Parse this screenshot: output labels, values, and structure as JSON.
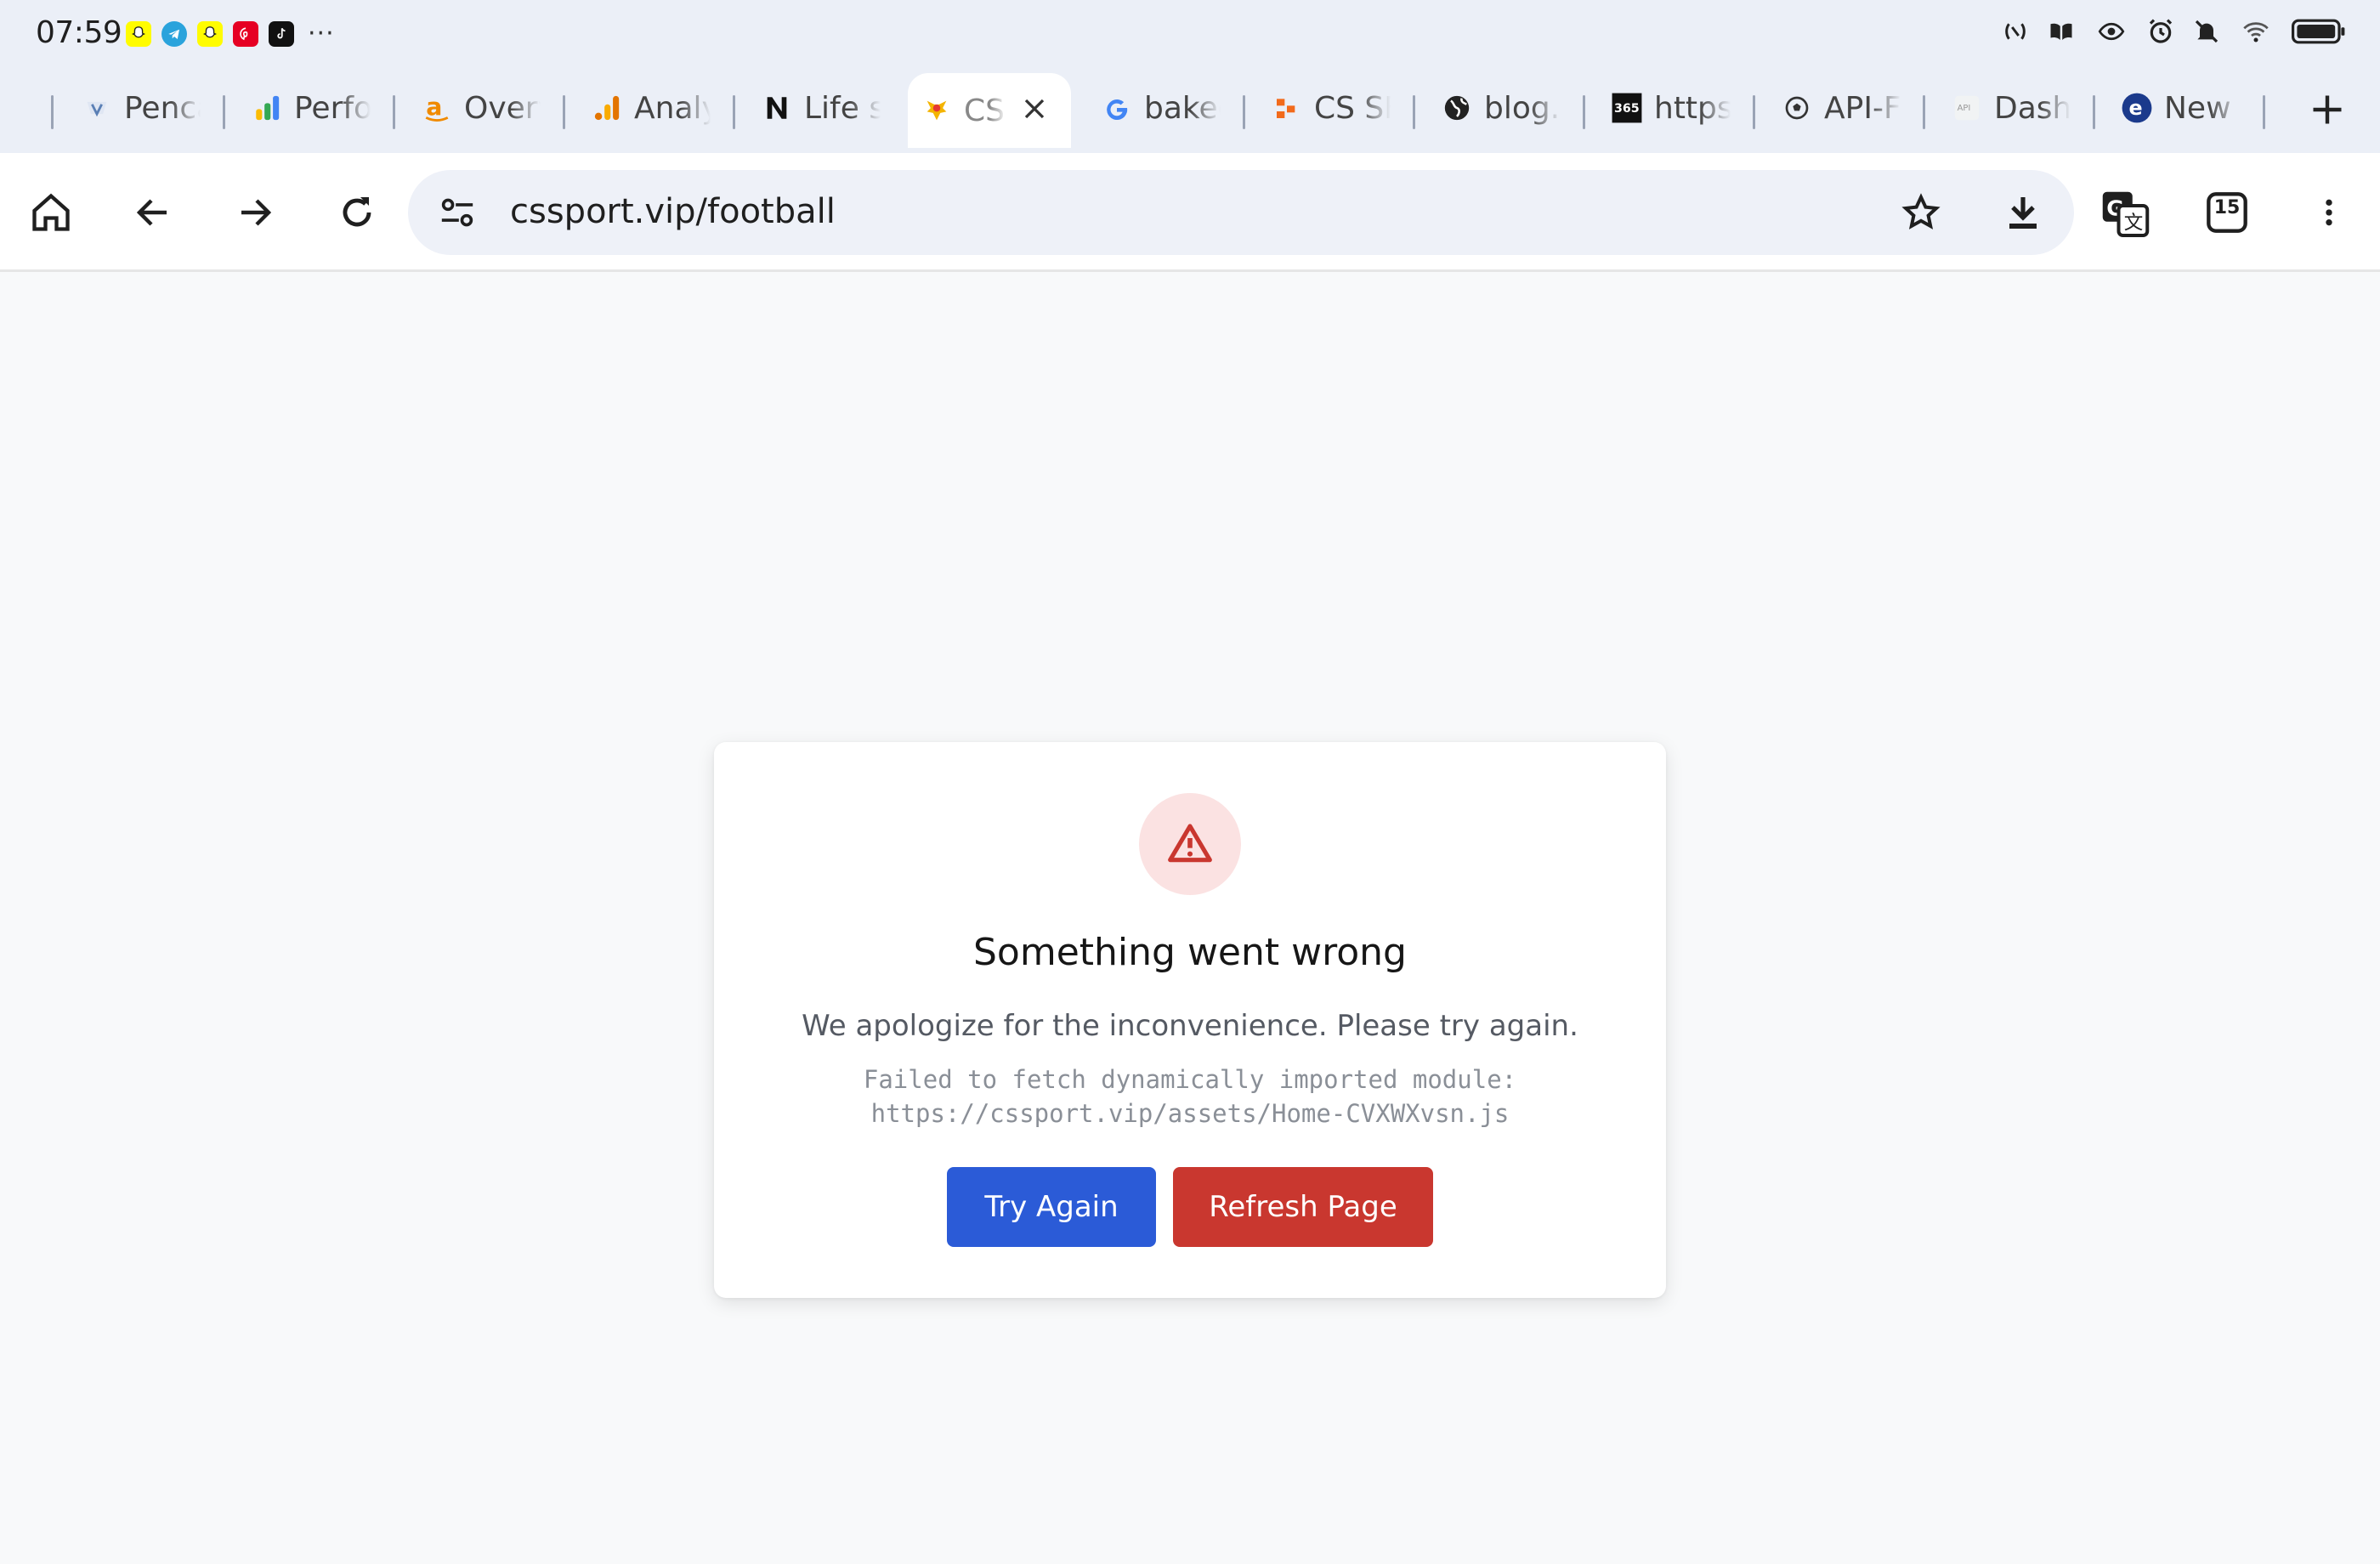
{
  "status_bar": {
    "time": "07:59",
    "more_notifications": "···",
    "notification_icons": [
      "snapchat-icon",
      "telegram-icon",
      "snapchat-icon",
      "pinterest-icon",
      "tiktok-icon"
    ],
    "system_icons": [
      "nfc-icon",
      "book-icon",
      "eye-icon",
      "alarm-icon",
      "mute-icon",
      "wifi-icon",
      "battery-icon"
    ]
  },
  "tabs": [
    {
      "title": "Penca",
      "icon": "pencil-favicon",
      "active": false
    },
    {
      "title": "Perfo",
      "icon": "google-ads-favicon",
      "active": false
    },
    {
      "title": "Overv",
      "icon": "amazon-favicon",
      "active": false
    },
    {
      "title": "Analy",
      "icon": "analytics-favicon",
      "active": false
    },
    {
      "title": "Life s",
      "icon": "notion-favicon",
      "active": false
    },
    {
      "title": "CS",
      "icon": "cssport-favicon",
      "active": true
    },
    {
      "title": "bakec",
      "icon": "google-favicon",
      "active": false
    },
    {
      "title": "CS SF",
      "icon": "cs-favicon",
      "active": false
    },
    {
      "title": "blog.c",
      "icon": "globe-favicon",
      "active": false
    },
    {
      "title": "https",
      "icon": "365-favicon",
      "active": false
    },
    {
      "title": "API-F",
      "icon": "football-favicon",
      "active": false
    },
    {
      "title": "Dashl",
      "icon": "api-favicon",
      "active": false
    },
    {
      "title": "New",
      "icon": "edge-favicon",
      "active": false
    }
  ],
  "toolbar": {
    "url": "cssport.vip/football",
    "tab_count": "15"
  },
  "error": {
    "title": "Something went wrong",
    "message": "We apologize for the inconvenience. Please try again.",
    "detail_line1": "Failed to fetch dynamically imported module:",
    "detail_line2": "https://cssport.vip/assets/Home-CVXWXvsn.js",
    "try_again_label": "Try Again",
    "refresh_label": "Refresh Page"
  },
  "colors": {
    "try_again": "#2b5bd7",
    "refresh": "#c9372f",
    "error_icon": "#c9372f",
    "error_icon_bg": "#fbe2e2"
  }
}
